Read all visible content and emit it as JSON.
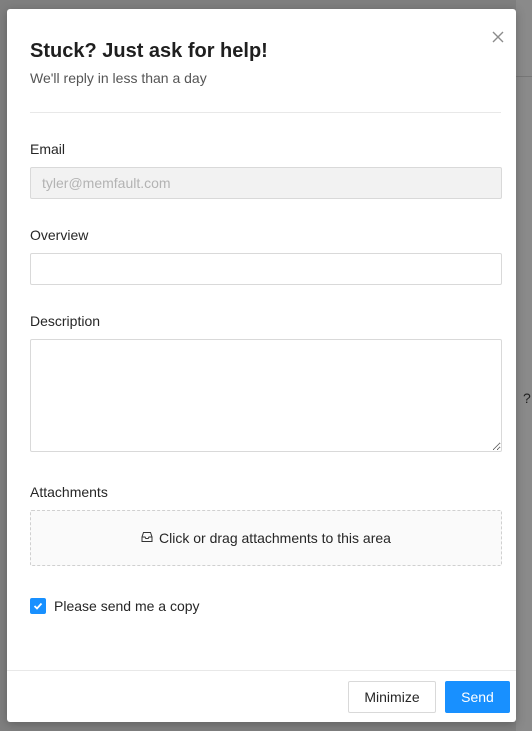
{
  "modal": {
    "title": "Stuck? Just ask for help!",
    "subtitle": "We'll reply in less than a day"
  },
  "form": {
    "email_label": "Email",
    "email_placeholder": "tyler@memfault.com",
    "overview_label": "Overview",
    "overview_value": "",
    "description_label": "Description",
    "description_value": "",
    "attachments_label": "Attachments",
    "dropzone_text": "Click or drag attachments to this area",
    "copy_checkbox_label": "Please send me a copy",
    "copy_checked": true
  },
  "footer": {
    "minimize_label": "Minimize",
    "send_label": "Send"
  },
  "colors": {
    "primary": "#1890ff",
    "border": "#d9d9d9",
    "disabled_bg": "#f2f2f2"
  },
  "icons": {
    "close": "close-icon",
    "inbox": "inbox-icon",
    "check": "check-icon"
  }
}
